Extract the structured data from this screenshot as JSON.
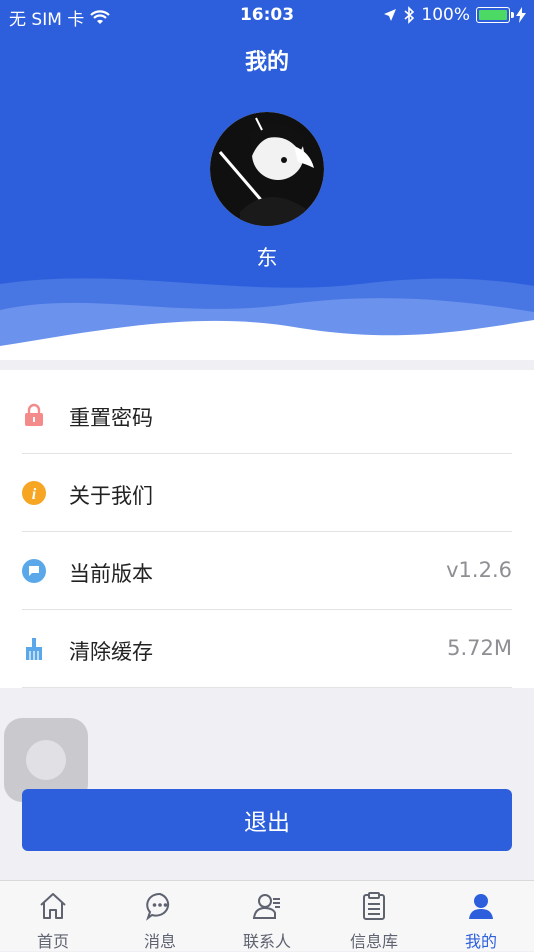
{
  "status_bar": {
    "carrier": "无 SIM 卡",
    "time": "16:03",
    "battery": "100%",
    "battery_color": "#4cd964"
  },
  "header": {
    "title": "我的",
    "username": "东",
    "background": "#2d5fdc"
  },
  "menu": {
    "items": [
      {
        "label": "重置密码",
        "value": "",
        "icon": "lock-icon"
      },
      {
        "label": "关于我们",
        "value": "",
        "icon": "info-icon"
      },
      {
        "label": "当前版本",
        "value": "v1.2.6",
        "icon": "chat-bubble-icon"
      },
      {
        "label": "清除缓存",
        "value": "5.72M",
        "icon": "broom-icon"
      }
    ]
  },
  "logout_label": "退出",
  "tabbar": {
    "active_color": "#2d5fdc",
    "items": [
      {
        "label": "首页",
        "icon": "home-icon"
      },
      {
        "label": "消息",
        "icon": "message-icon"
      },
      {
        "label": "联系人",
        "icon": "contacts-icon"
      },
      {
        "label": "信息库",
        "icon": "clipboard-icon"
      },
      {
        "label": "我的",
        "icon": "person-icon"
      }
    ]
  }
}
